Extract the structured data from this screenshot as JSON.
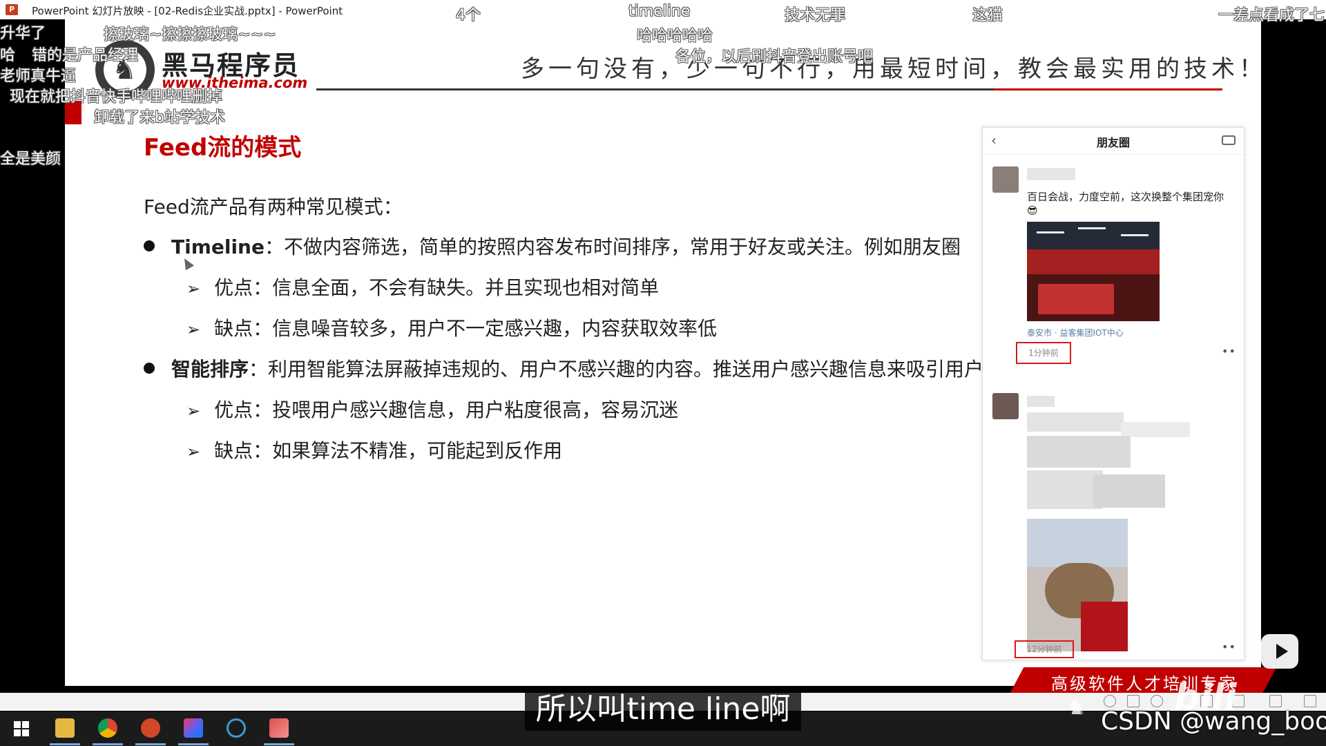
{
  "window": {
    "title": "PowerPoint 幻灯片放映 - [02-Redis企业实战.pptx] - PowerPoint",
    "app_icon": "powerpoint-icon"
  },
  "slide": {
    "brand_name": "黑马程序员",
    "brand_url": "www.itheima.com",
    "slogan": "多一句没有，少一句不行，用最短时间，教会最实用的技术！",
    "title": "Feed流的模式",
    "intro": "Feed流产品有两种常见模式：",
    "bullets": [
      {
        "head": "Timeline",
        "text": "：不做内容筛选，简单的按照内容发布时间排序，常用于好友或关注。例如朋友圈",
        "subs": [
          "优点：信息全面，不会有缺失。并且实现也相对简单",
          "缺点：信息噪音较多，用户不一定感兴趣，内容获取效率低"
        ]
      },
      {
        "head": "智能排序",
        "text": "：利用智能算法屏蔽掉违规的、用户不感兴趣的内容。推送用户感兴趣信息来吸引用户",
        "subs": [
          "优点：投喂用户感兴趣信息，用户粘度很高，容易沉迷",
          "缺点：如果算法不精准，可能起到反作用"
        ]
      }
    ],
    "banner": "高级软件人才培训专家"
  },
  "phone": {
    "title": "朋友圈",
    "post1": {
      "text": "百日会战，力度空前，这次换整个集团宠你😎",
      "location": "泰安市 · 益客集团IOT中心",
      "time": "1分钟前"
    },
    "post2": {
      "time": "12分钟前"
    }
  },
  "danmaku": [
    "升华了",
    "哈",
    "错的是产品经理",
    "老师真牛逼",
    "现在就把抖音快手哔哩哔哩删掉",
    "卸载了来b站学技术",
    "全是美颜",
    "擦玻璃~擦擦擦玻璃~~~",
    "4个",
    "timeline",
    "哈哈哈哈哈",
    "各位，以后刷抖音登出账号吧",
    "技术无罪",
    "这猫",
    "一差点看成了七"
  ],
  "subtitle": "所以叫time line啊",
  "watermark": "CSDN @wang_book"
}
